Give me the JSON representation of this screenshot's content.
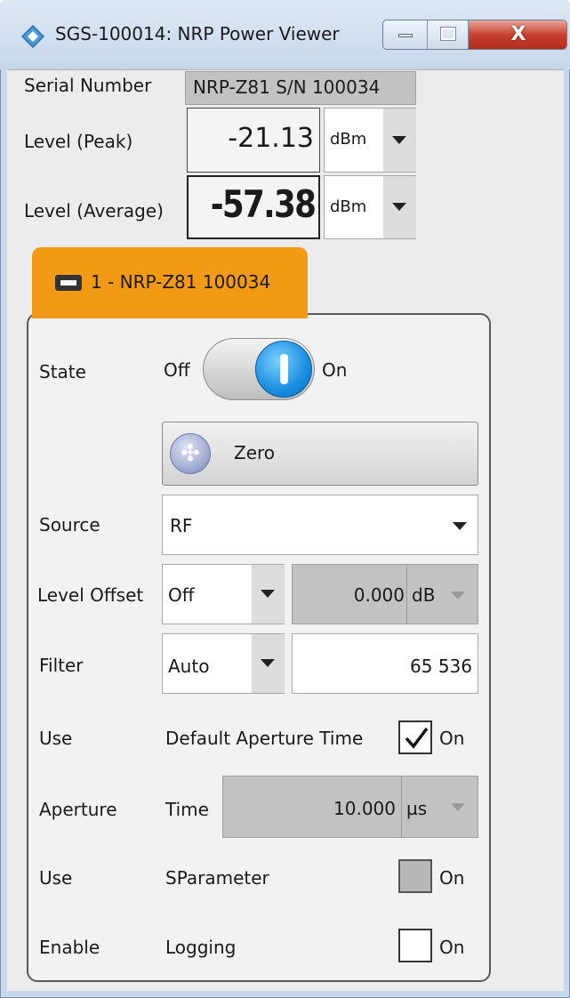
{
  "window": {
    "title": "SGS-100014: NRP Power Viewer",
    "close_glyph": "X",
    "accent_color": "#f39a14"
  },
  "header": {
    "serial_label": "Serial Number",
    "serial_value": "NRP-Z81 S/N 100034",
    "level_peak_label": "Level (Peak)",
    "level_peak_value": "-21.13",
    "level_peak_unit": "dBm",
    "level_avg_label": "Level (Average)",
    "level_avg_value": "-57.38",
    "level_avg_unit": "dBm"
  },
  "tab": {
    "label": "1 - NRP-Z81 100034",
    "icon": "usb-icon"
  },
  "settings": {
    "state_label": "State",
    "state_off": "Off",
    "state_on": "On",
    "state_value": true,
    "zero_button": "Zero",
    "source_label": "Source",
    "source_value": "RF",
    "level_offset_label": "Level Offset",
    "level_offset_mode": "Off",
    "level_offset_value": "0.000",
    "level_offset_unit": "dB",
    "filter_label": "Filter",
    "filter_mode": "Auto",
    "filter_value": "65 536",
    "use_aperture_label": "Use",
    "use_aperture_text": "Default Aperture Time",
    "use_aperture_on": "On",
    "use_aperture_checked": true,
    "aperture_label": "Aperture",
    "aperture_time_label": "Time",
    "aperture_value": "10.000",
    "aperture_unit": "µs",
    "use_sparam_label": "Use",
    "use_sparam_text": "SParameter",
    "use_sparam_on": "On",
    "use_sparam_checked": false,
    "enable_label": "Enable",
    "enable_text": "Logging",
    "enable_on": "On",
    "enable_checked": false
  }
}
